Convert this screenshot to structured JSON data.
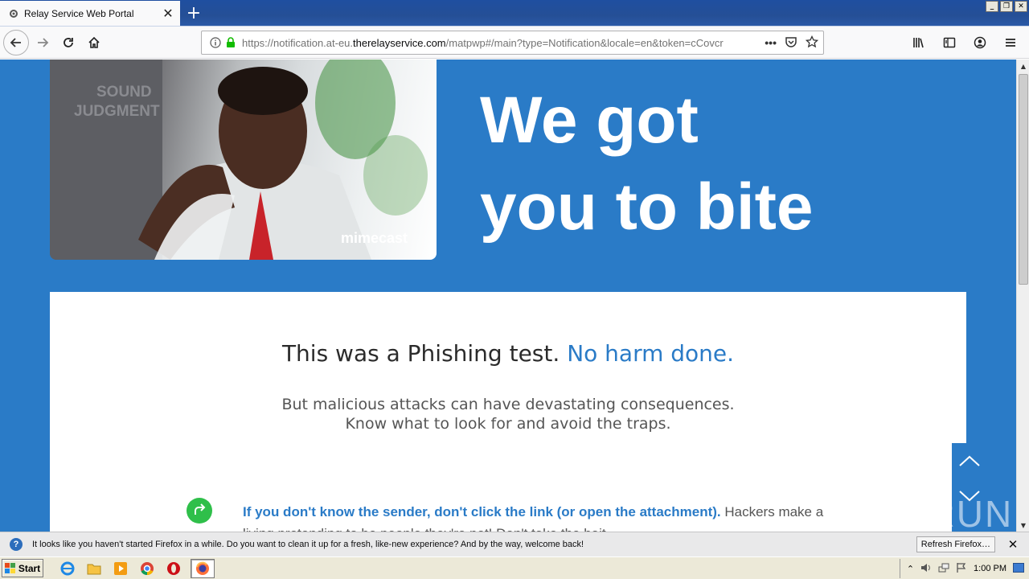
{
  "browser": {
    "tab": {
      "title": "Relay Service Web Portal"
    },
    "url": {
      "prefix": "https://notification.at-eu.",
      "host": "therelayservice.com",
      "path": "/matpwp#/main?type=Notification&locale=en&token=cCovcr"
    }
  },
  "page": {
    "hero_brand": "mimecast",
    "hero_image_text_1": "SOUND",
    "hero_image_text_2": "JUDGMENT",
    "headline_line1": "We got",
    "headline_line2": "you to bite",
    "title_main": "This was a Phishing test.",
    "title_accent": "No harm done.",
    "subtitle_line1": "But malicious attacks can have devastating consequences.",
    "subtitle_line2": "Know what to look for and avoid the traps.",
    "tip_strong": "If you don't know the sender, don't click the link (or open the attachment).",
    "tip_rest": "Hackers make a living pretending to be people they're not! Don't take the bait."
  },
  "watermark": "ANY RUN",
  "notification": {
    "message": "It looks like you haven't started Firefox in a while. Do you want to clean it up for a fresh, like-new experience? And by the way, welcome back!",
    "button": "Refresh Firefox…"
  },
  "taskbar": {
    "start": "Start",
    "clock": "1:00 PM"
  },
  "colors": {
    "page_blue": "#2a7bc7",
    "tip_green": "#2fbf4a"
  }
}
